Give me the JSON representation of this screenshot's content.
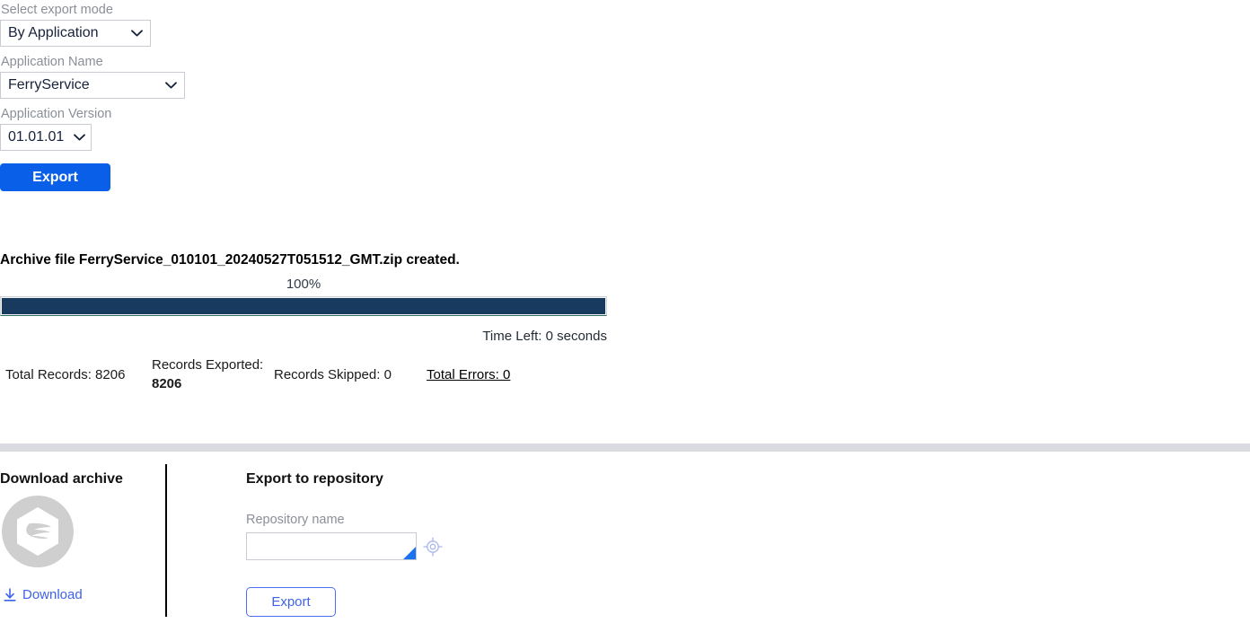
{
  "export_form": {
    "mode_label": "Select export mode",
    "mode_value": "By Application",
    "mode_options": [
      "By Application"
    ],
    "app_name_label": "Application Name",
    "app_name_value": "FerryService",
    "app_name_options": [
      "FerryService"
    ],
    "app_version_label": "Application Version",
    "app_version_value": "01.01.01",
    "app_version_options": [
      "01.01.01"
    ],
    "export_button_label": "Export"
  },
  "status": {
    "archive_message": "Archive file FerryService_010101_20240527T051512_GMT.zip created.",
    "progress_percent_label": "100%",
    "progress_value": 100,
    "time_left": "Time Left: 0 seconds"
  },
  "stats": {
    "total_records_label": "Total Records: 8206",
    "records_exported_label": "Records Exported:",
    "records_exported_value": "8206",
    "records_skipped_label": "Records Skipped: 0",
    "total_errors_label": "Total Errors: 0"
  },
  "download_section": {
    "heading": "Download archive",
    "icon_name": "archive-package-icon",
    "download_link_label": "Download"
  },
  "repository_section": {
    "heading": "Export to repository",
    "repository_name_label": "Repository name",
    "repository_name_value": "",
    "repository_name_placeholder": "",
    "target_icon_name": "repository-target-icon",
    "export_button_label": "Export"
  },
  "colors": {
    "primary_button": "#0a5fe8",
    "progress_fill": "#173a5e",
    "link_blue": "#3f62e8",
    "divider_band": "#d9dbe0",
    "label_gray": "#8a8f98"
  }
}
